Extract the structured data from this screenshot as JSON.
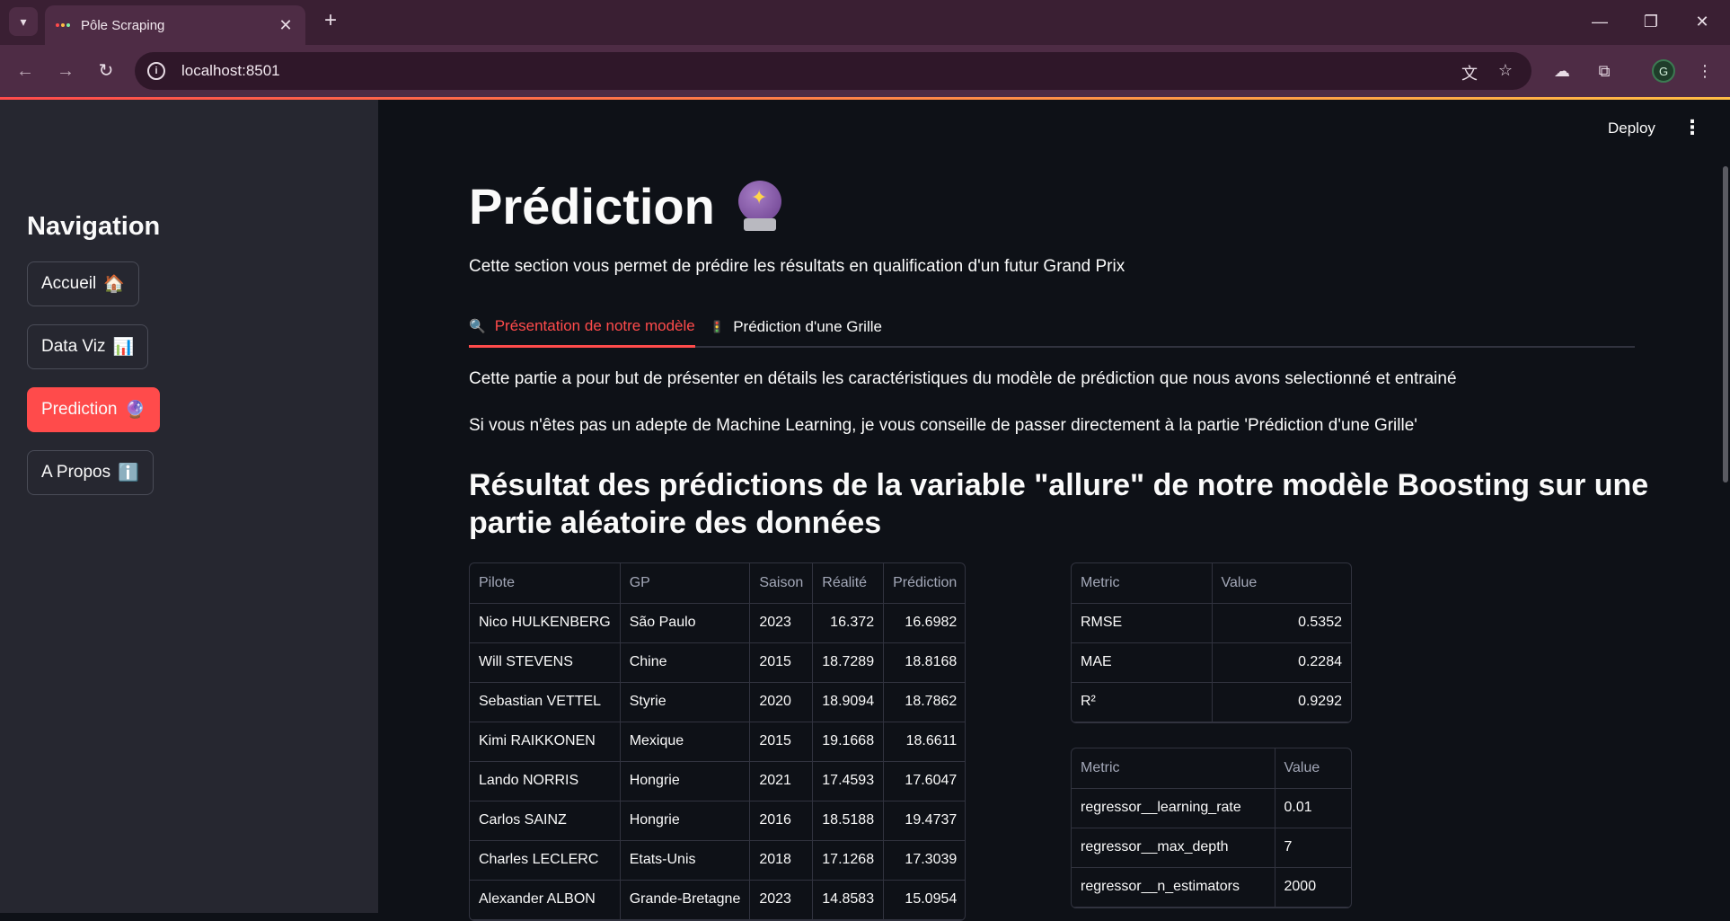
{
  "browser": {
    "tab_title": "Pôle Scraping",
    "url": "localhost:8501",
    "profile_initial": "G"
  },
  "app": {
    "deploy_label": "Deploy",
    "sidebar": {
      "heading": "Navigation",
      "items": [
        {
          "label": "Accueil",
          "emoji": "🏠"
        },
        {
          "label": "Data Viz",
          "emoji": "📊"
        },
        {
          "label": "Prediction",
          "emoji": "🔮"
        },
        {
          "label": "A Propos",
          "emoji": "ℹ️"
        }
      ]
    },
    "page": {
      "title": "Prédiction",
      "subtitle": "Cette section vous permet de prédire les résultats en qualification d'un futur Grand Prix",
      "tabs": [
        {
          "label": "Présentation de notre modèle",
          "emoji": "🔍"
        },
        {
          "label": "Prédiction d'une Grille",
          "emoji": "🚦"
        }
      ],
      "para1": "Cette partie a pour but de présenter en détails les caractéristiques du modèle de prédiction que nous avons selectionné et entrainé",
      "para2": "Si vous n'êtes pas un adepte de Machine Learning, je vous conseille de passer directement à la partie 'Prédiction d'une Grille'",
      "section_title": "Résultat des prédictions de la variable \"allure\" de notre modèle Boosting sur une partie aléatoire des données"
    },
    "predictions_table": {
      "headers": [
        "Pilote",
        "GP",
        "Saison",
        "Réalité",
        "Prédiction"
      ],
      "rows": [
        [
          "Nico HULKENBERG",
          "São Paulo",
          "2023",
          "16.372",
          "16.6982"
        ],
        [
          "Will STEVENS",
          "Chine",
          "2015",
          "18.7289",
          "18.8168"
        ],
        [
          "Sebastian VETTEL",
          "Styrie",
          "2020",
          "18.9094",
          "18.7862"
        ],
        [
          "Kimi RAIKKONEN",
          "Mexique",
          "2015",
          "19.1668",
          "18.6611"
        ],
        [
          "Lando NORRIS",
          "Hongrie",
          "2021",
          "17.4593",
          "17.6047"
        ],
        [
          "Carlos SAINZ",
          "Hongrie",
          "2016",
          "18.5188",
          "19.4737"
        ],
        [
          "Charles LECLERC",
          "Etats-Unis",
          "2018",
          "17.1268",
          "17.3039"
        ],
        [
          "Alexander ALBON",
          "Grande-Bretagne",
          "2023",
          "14.8583",
          "15.0954"
        ]
      ]
    },
    "metrics_table": {
      "headers": [
        "Metric",
        "Value"
      ],
      "rows": [
        [
          "RMSE",
          "0.5352"
        ],
        [
          "MAE",
          "0.2284"
        ],
        [
          "R²",
          "0.9292"
        ]
      ]
    },
    "params_table": {
      "headers": [
        "Metric",
        "Value"
      ],
      "rows": [
        [
          "regressor__learning_rate",
          "0.01"
        ],
        [
          "regressor__max_depth",
          "7"
        ],
        [
          "regressor__n_estimators",
          "2000"
        ]
      ]
    },
    "colors": {
      "accent": "#ff4b4b",
      "background": "#0e1117",
      "sidebar": "#262730"
    }
  }
}
